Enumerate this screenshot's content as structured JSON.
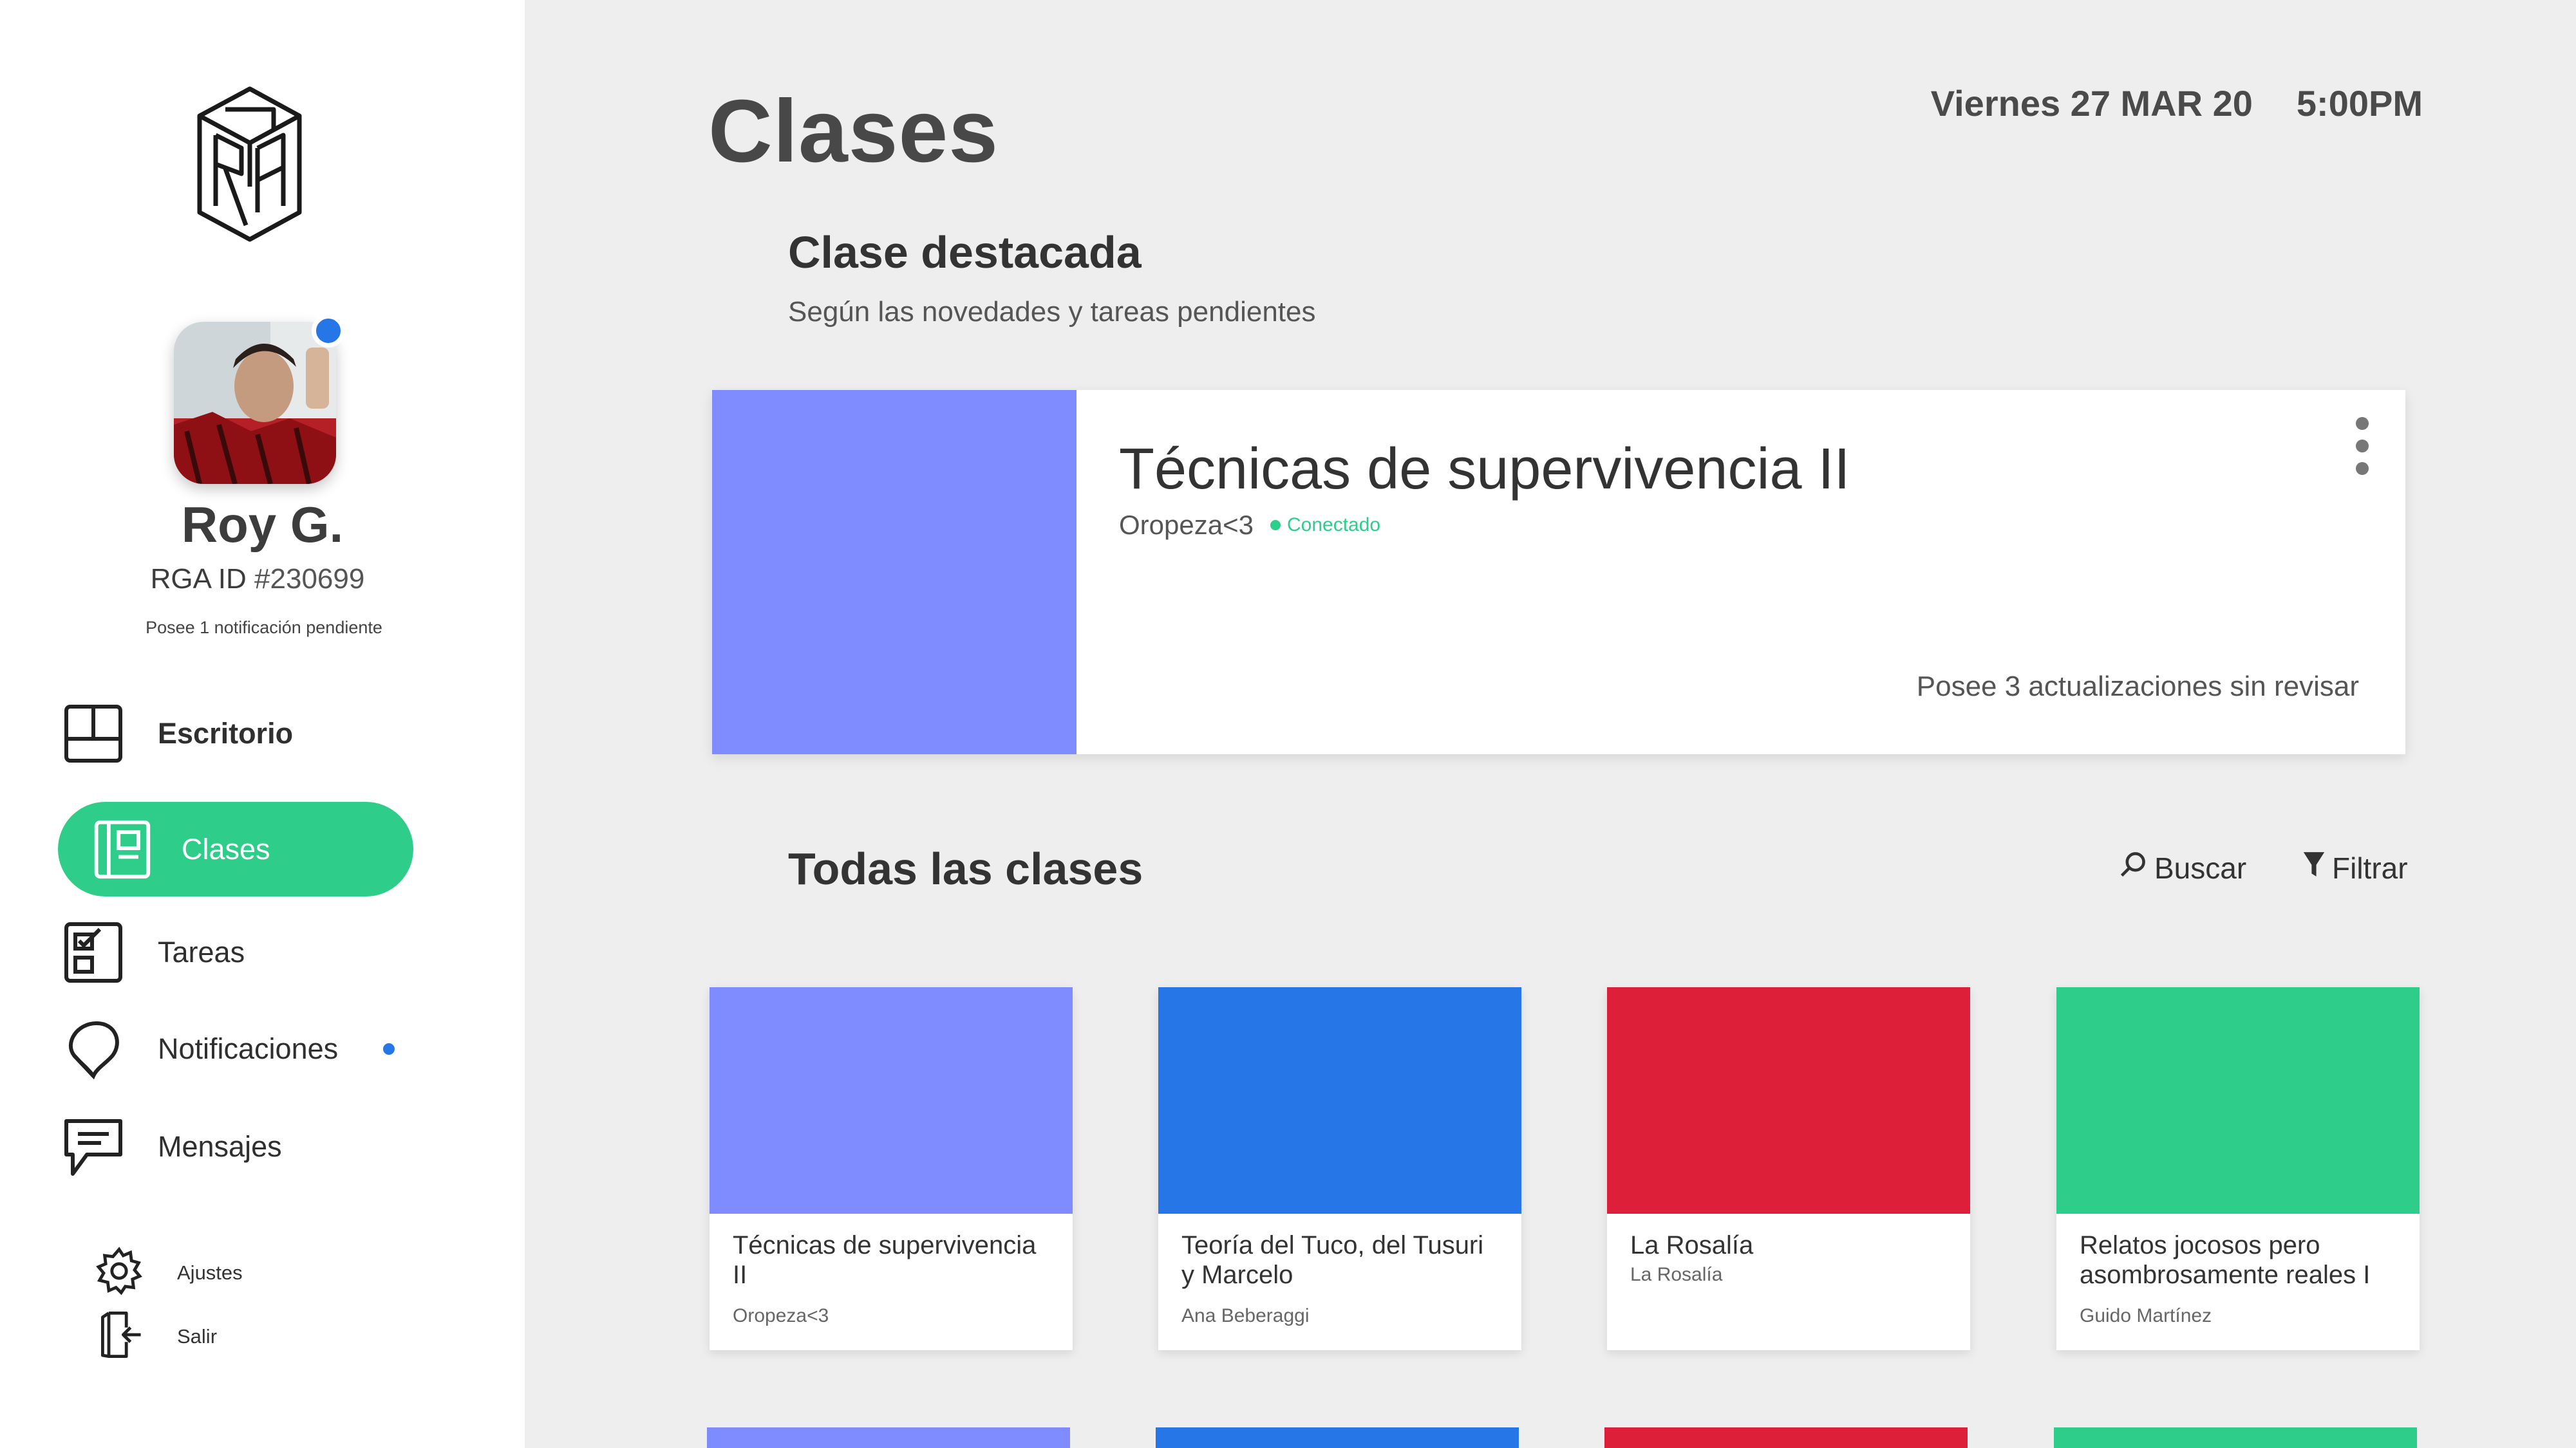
{
  "sidebar": {
    "user": {
      "name": "Roy G.",
      "id_prefix": "RGA ID",
      "id_number": "#230699",
      "notice": "Posee 1 notificación pendiente"
    },
    "nav": [
      {
        "label": "Escritorio",
        "icon": "desktop-icon"
      },
      {
        "label": "Clases",
        "icon": "book-icon",
        "active": true
      },
      {
        "label": "Tareas",
        "icon": "checklist-icon"
      },
      {
        "label": "Notificaciones",
        "icon": "bell-icon",
        "has_dot": true
      },
      {
        "label": "Mensajes",
        "icon": "message-icon"
      }
    ],
    "settings_label": "Ajustes",
    "logout_label": "Salir"
  },
  "header": {
    "title": "Clases",
    "date": "Viernes 27 MAR 20",
    "time": "5:00PM"
  },
  "featured_section": {
    "title": "Clase destacada",
    "subtitle": "Según las novedades y tareas pendientes"
  },
  "featured_card": {
    "title": "Técnicas de supervivencia II",
    "teacher": "Oropeza<3",
    "status": "Conectado",
    "updates": "Posee 3 actualizaciones sin revisar",
    "color": "#7f8cff"
  },
  "all_section": {
    "title": "Todas las clases",
    "search_label": "Buscar",
    "filter_label": "Filtrar"
  },
  "classes": [
    {
      "title": "Técnicas de supervivencia II",
      "teacher": "Oropeza<3",
      "color": "#7f8cff"
    },
    {
      "title": "Teoría del Tuco, del Tusuri y Marcelo",
      "teacher": "Ana Beberaggi",
      "color": "#2676e8"
    },
    {
      "title": "La Rosalía",
      "teacher": "La Rosalía",
      "color": "#dd1f39"
    },
    {
      "title": "Relatos jocosos pero asombrosamente reales I",
      "teacher": "Guido Martínez",
      "color": "#2ecd8a"
    }
  ],
  "colors": {
    "accent": "#2ecd8a",
    "notification": "#2676e8",
    "sidebar_bg": "#ffffff",
    "main_bg": "#eeeeee"
  }
}
